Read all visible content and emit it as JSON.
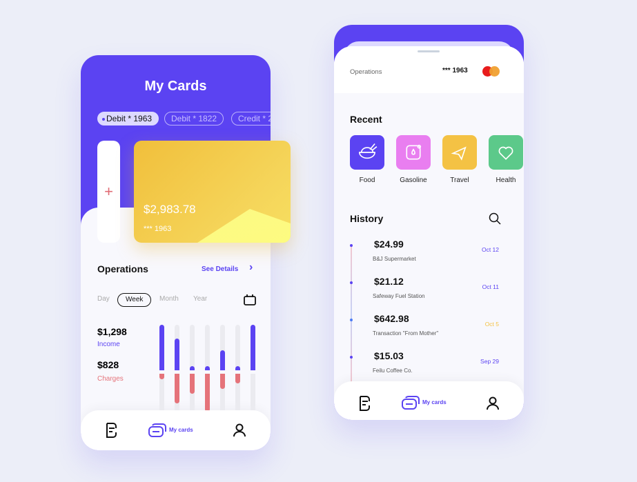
{
  "left": {
    "title": "My Cards",
    "pills": [
      "Debit * 1963",
      "Debit * 1822",
      "Credit * 2"
    ],
    "add_label": "+",
    "card": {
      "balance": "$2,983.78",
      "number": "*** 1963"
    },
    "operations": {
      "title": "Operations",
      "see_details": "See Details",
      "chevron": "›"
    },
    "tabs": [
      "Day",
      "Week",
      "Month",
      "Year"
    ],
    "active_tab": "Week",
    "income": {
      "value": "$1,298",
      "label": "Income"
    },
    "charges": {
      "value": "$828",
      "label": "Charges"
    },
    "nav": {
      "active_label": "My cards"
    }
  },
  "chart_data": {
    "type": "bar",
    "income": [
      66,
      46,
      6,
      6,
      29,
      6,
      66
    ],
    "charges": [
      8,
      43,
      29,
      55,
      22,
      14,
      0
    ],
    "colors": {
      "income": "#5b43f2",
      "charges": "#e5737a",
      "track": "#ebebf0"
    }
  },
  "right": {
    "header": {
      "label": "Operations",
      "card": "*** 1963"
    },
    "recent_title": "Recent",
    "recent": [
      {
        "label": "Food",
        "color": "#5b43f2"
      },
      {
        "label": "Gasoline",
        "color": "#e97ef0"
      },
      {
        "label": "Travel",
        "color": "#f4c244"
      },
      {
        "label": "Health",
        "color": "#5cc98a"
      }
    ],
    "history_title": "History",
    "history": [
      {
        "amount": "$24.99",
        "desc": "B&J Supermarket",
        "date": "Oct 12",
        "color": "#5b43f2"
      },
      {
        "amount": "$21.12",
        "desc": "Safeway Fuel Station",
        "date": "Oct 11",
        "color": "#5b43f2"
      },
      {
        "amount": "$642.98",
        "desc": "Transaction \"From Mother\"",
        "date": "Oct 5",
        "color": "#f4c244"
      },
      {
        "amount": "$15.03",
        "desc": "Feilu Coffee Co.",
        "date": "Sep 29",
        "color": "#5b43f2"
      }
    ],
    "nav": {
      "active_label": "My cards"
    }
  }
}
